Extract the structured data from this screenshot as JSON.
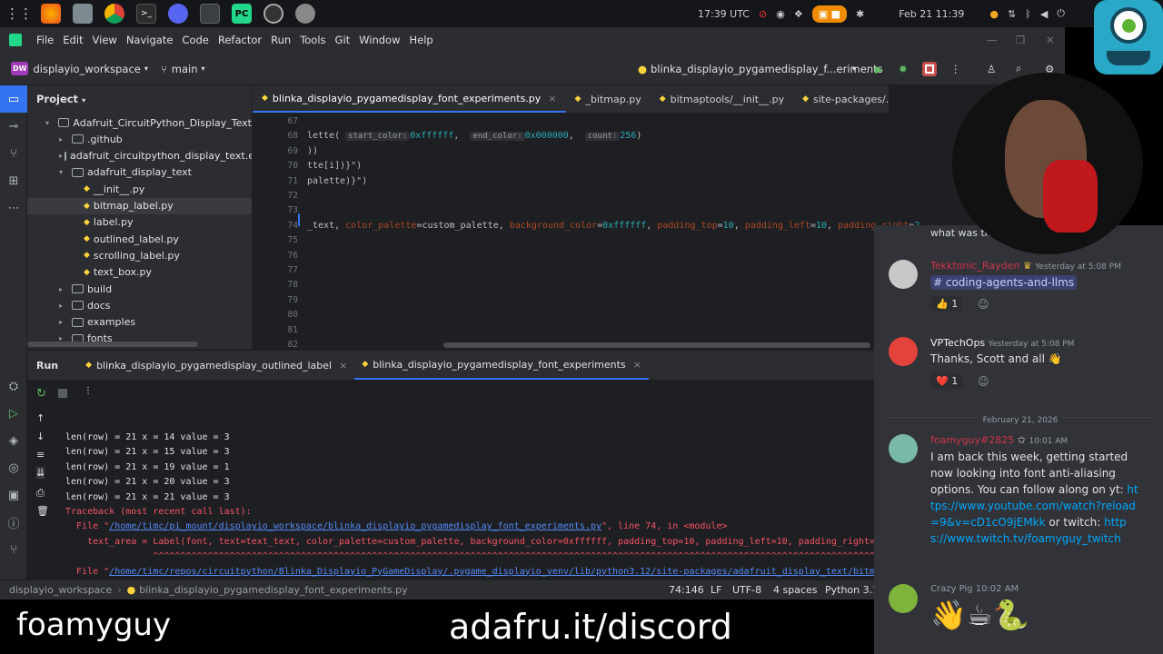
{
  "taskbar": {
    "clock": "17:39 UTC",
    "date": "Feb 21 11:39"
  },
  "menu": [
    "File",
    "Edit",
    "View",
    "Navigate",
    "Code",
    "Refactor",
    "Run",
    "Tools",
    "Git",
    "Window",
    "Help"
  ],
  "toolbar": {
    "project_badge": "DW",
    "project": "displayio_workspace",
    "branch": "main",
    "run_config": "blinka_displayio_pygamedisplay_f...eriments"
  },
  "project_panel": {
    "title": "Project",
    "items": [
      {
        "label": "Adafruit_CircuitPython_Display_Text",
        "kind": "folder",
        "depth": 1,
        "open": true
      },
      {
        "label": ".github",
        "kind": "folder",
        "depth": 2,
        "open": false
      },
      {
        "label": "adafruit_circuitpython_display_text.egg",
        "kind": "folder",
        "depth": 2,
        "open": false
      },
      {
        "label": "adafruit_display_text",
        "kind": "folder",
        "depth": 2,
        "open": true
      },
      {
        "label": "__init__.py",
        "kind": "file",
        "depth": 3
      },
      {
        "label": "bitmap_label.py",
        "kind": "file",
        "depth": 3,
        "selected": true
      },
      {
        "label": "label.py",
        "kind": "file",
        "depth": 3
      },
      {
        "label": "outlined_label.py",
        "kind": "file",
        "depth": 3
      },
      {
        "label": "scrolling_label.py",
        "kind": "file",
        "depth": 3
      },
      {
        "label": "text_box.py",
        "kind": "file",
        "depth": 3
      },
      {
        "label": "build",
        "kind": "folder",
        "depth": 2,
        "open": false
      },
      {
        "label": "docs",
        "kind": "folder",
        "depth": 2,
        "open": false
      },
      {
        "label": "examples",
        "kind": "folder",
        "depth": 2,
        "open": false
      },
      {
        "label": "fonts",
        "kind": "folder",
        "depth": 2,
        "open": false
      }
    ]
  },
  "editor_tabs": [
    {
      "label": "blinka_displayio_pygamedisplay_font_experiments.py",
      "active": true,
      "close": "×"
    },
    {
      "label": "_bitmap.py"
    },
    {
      "label": "bitmaptools/__init__.py"
    },
    {
      "label": "site-packages/.../bitmap_label.py"
    },
    {
      "label": "g"
    }
  ],
  "editor": {
    "warn_count": "8",
    "lines": [
      {
        "n": "67",
        "parts": []
      },
      {
        "n": "68",
        "parts": [
          {
            "t": "lette( "
          },
          {
            "h": "start_color:"
          },
          {
            "c": "0xffffff"
          },
          {
            "t": ",  "
          },
          {
            "h": "end_color:"
          },
          {
            "c": "0x000000"
          },
          {
            "t": ",  "
          },
          {
            "h": "count:"
          },
          {
            "c": "256"
          },
          {
            "t": ")"
          }
        ]
      },
      {
        "n": "69",
        "parts": [
          {
            "t": "))"
          }
        ]
      },
      {
        "n": "70",
        "parts": [
          {
            "t": "tte[i])}\")"
          }
        ]
      },
      {
        "n": "71",
        "parts": [
          {
            "t": "palette)}\")"
          }
        ]
      },
      {
        "n": "72",
        "parts": []
      },
      {
        "n": "73",
        "parts": []
      },
      {
        "n": "74",
        "parts": [
          {
            "t": "_text, "
          },
          {
            "k": "color_palette"
          },
          {
            "t": "=custom_palette, "
          },
          {
            "k": "background_color"
          },
          {
            "t": "="
          },
          {
            "c": "0xffffff"
          },
          {
            "t": ", "
          },
          {
            "k": "padding_top"
          },
          {
            "t": "="
          },
          {
            "c": "10"
          },
          {
            "t": ", "
          },
          {
            "k": "padding_left"
          },
          {
            "t": "="
          },
          {
            "c": "10"
          },
          {
            "t": ", "
          },
          {
            "k": "padding_right"
          },
          {
            "t": "="
          },
          {
            "c": "2"
          }
        ]
      },
      {
        "n": "75",
        "parts": []
      },
      {
        "n": "76",
        "parts": []
      },
      {
        "n": "77",
        "parts": []
      },
      {
        "n": "78",
        "parts": []
      },
      {
        "n": "79",
        "parts": []
      },
      {
        "n": "80",
        "parts": []
      },
      {
        "n": "81",
        "parts": []
      },
      {
        "n": "82",
        "parts": []
      }
    ]
  },
  "run": {
    "title": "Run",
    "tabs": [
      {
        "label": "blinka_displayio_pygamedisplay_outlined_label",
        "close": "×"
      },
      {
        "label": "blinka_displayio_pygamedisplay_font_experiments",
        "close": "×",
        "active": true
      }
    ]
  },
  "console": [
    {
      "text": "len(row) = 21 x = 14 value = 3",
      "type": "normal"
    },
    {
      "text": "len(row) = 21 x = 15 value = 3",
      "type": "normal"
    },
    {
      "text": "len(row) = 21 x = 19 value = 1",
      "type": "normal"
    },
    {
      "text": "len(row) = 21 x = 20 value = 3",
      "type": "normal"
    },
    {
      "text": "len(row) = 21 x = 21 value = 3",
      "type": "normal"
    },
    {
      "text": "Traceback (most recent call last):",
      "type": "err"
    },
    {
      "pre": "  File \"",
      "link": "/home/timc/pi_mount/displayio_workspace/blinka_displayio_pygamedisplay_font_experiments.py",
      "post": "\", line 74, in <module>",
      "type": "file"
    },
    {
      "text": "    text_area = Label(font, text=text_text, color_palette=custom_palette, background_color=0xffffff, padding_top=10, padding_left=10, padding_right=20, padding_bottom=10",
      "type": "err"
    },
    {
      "text": "                ^^^^^^^^^^^^^^^^^^^^^^^^^^^^^^^^^^^^^^^^^^^^^^^^^^^^^^^^^^^^^^^^^^^^^^^^^^^^^^^^^^^^^^^^^^^^^^^^^^^^^^^^^^^^^^^^^^^^^^^^^^^^^^^^^^^^^^^",
      "type": "err"
    },
    {
      "pre": "  File \"",
      "link": "/home/timc/repos/circuitpython/Blinka_Displayio_PyGameDisplay/.pygame_displayio_venv/lib/python3.12/site-packages/adafruit_display_text/bitmap_label.py",
      "post": "\", line 210, in",
      "type": "file"
    },
    {
      "text": "    self.update(True)",
      "type": "err"
    },
    {
      "pre": "  File \"",
      "link": "/home/timc/repos/circuitpython/Blinka_Displayio_PyGameDisplay/.pygame_displayio_venv/lib/python3.12/site-packages/adafruit_display_text/bitmap_label.py",
      "post": "\", line 834, in",
      "type": "file"
    }
  ],
  "statusbar": {
    "crumb1": "displayio_workspace",
    "crumb2": "blinka_displayio_pygamedisplay_font_experiments.py",
    "pos": "74:146",
    "eol": "LF",
    "enc": "UTF-8",
    "indent": "4 spaces",
    "interp": "Python 3.12"
  },
  "discord": {
    "top_fragment": "what was the channel spelling?",
    "messages": [
      {
        "user": "Tekktonic_Rayden",
        "user_color": "#d1344a",
        "time": "Yesterday at 5:08 PM",
        "channel": "# coding-agents-and-llms",
        "react_emoji": "👍",
        "react_count": "1"
      },
      {
        "user": "VPTechOps",
        "user_color": "#f2f3f5",
        "time": "Yesterday at 5:08 PM",
        "text": "Thanks, Scott and all 👋",
        "react_emoji": "❤️",
        "react_count": "1"
      }
    ],
    "date_divider": "February 21, 2026",
    "last": {
      "user": "foamyguy#2825",
      "user_color": "#d1344a",
      "time": "10:01 AM",
      "text": "I am back this week, getting started now looking into font anti-aliasing options. You can follow along on yt:",
      "link1": "https://www.youtube.com/watch?reload=9&v=cD1cO9jEMkk",
      "mid": " or twitch:",
      "link2": "https://www.twitch.tv/foamyguy_twitch"
    },
    "bottom_user": "Crazy Pig",
    "bottom_time": "10:02 AM",
    "bottom_emojis": "👋☕🐍"
  },
  "overlay": {
    "name": "foamyguy",
    "url": "adafru.it/discord"
  }
}
